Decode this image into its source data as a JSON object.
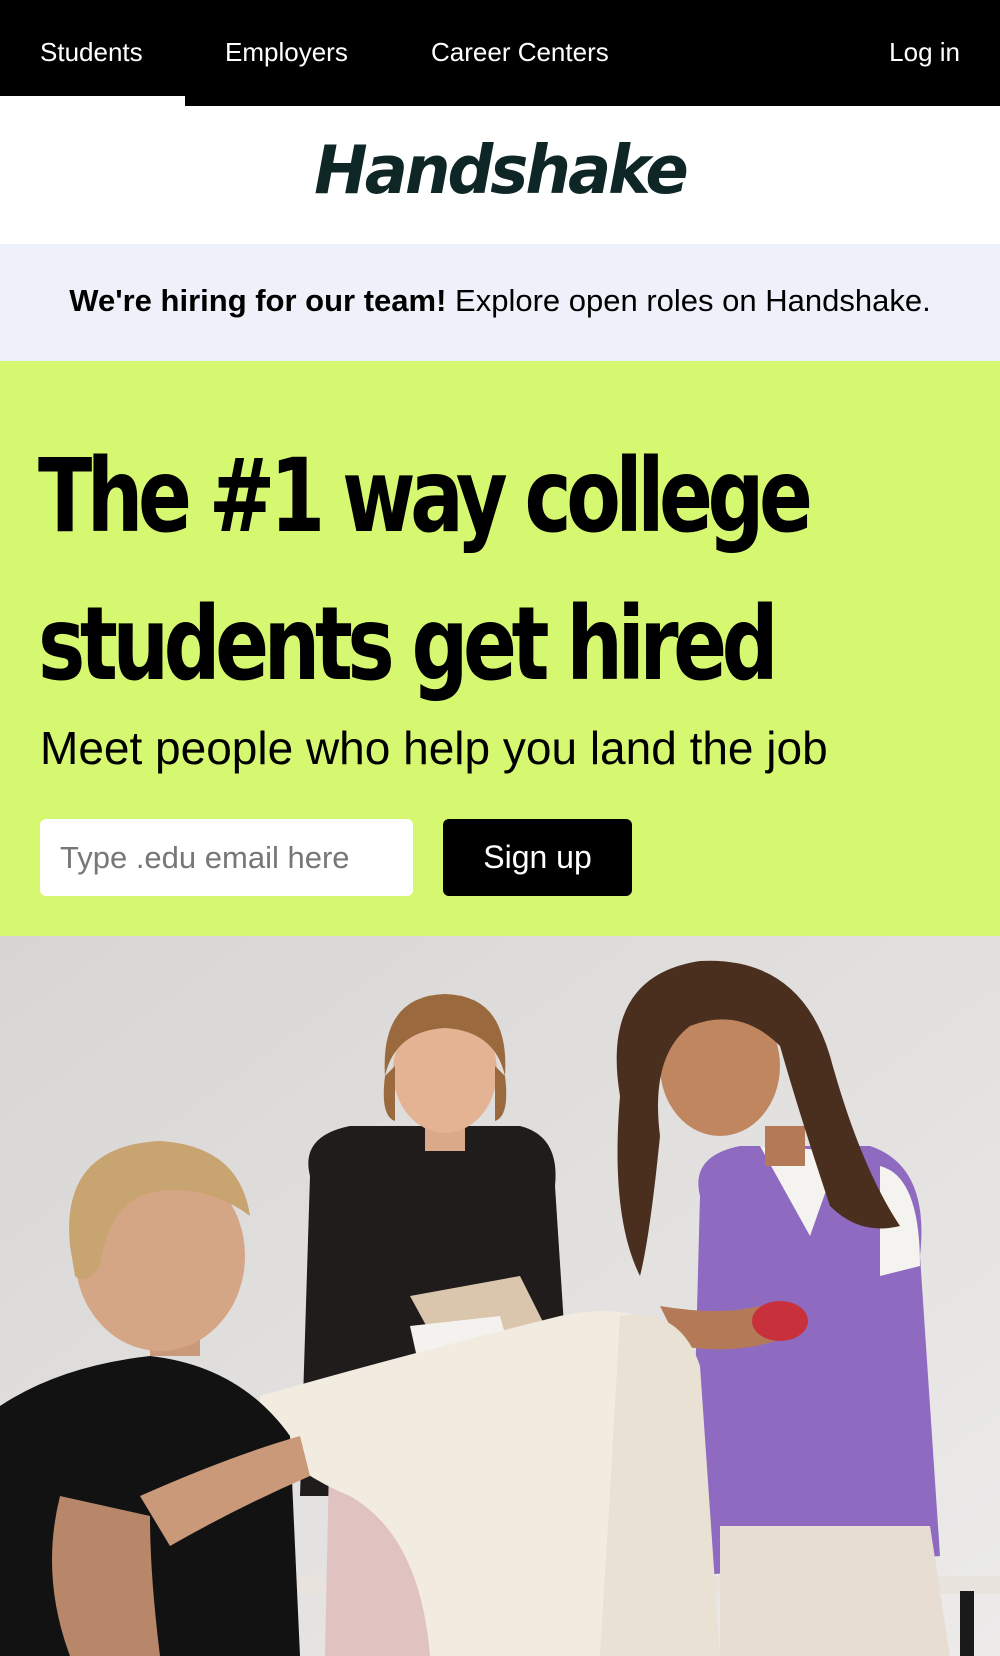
{
  "nav": {
    "items": [
      {
        "label": "Students",
        "active": true
      },
      {
        "label": "Employers"
      },
      {
        "label": "Career Centers"
      }
    ],
    "login_label": "Log in"
  },
  "logo": {
    "text": "Handshake"
  },
  "banner": {
    "bold": "We're hiring for our team!",
    "text": "Explore open roles on Handshake."
  },
  "hero": {
    "headline_line1": "The #1 way college",
    "headline_line2": "students get hired",
    "subheadline": "Meet people who help you land the job",
    "email_placeholder": "Type .edu email here",
    "email_value": "",
    "signup_label": "Sign up"
  },
  "colors": {
    "nav_bg": "#000000",
    "hero_bg": "#d6f871",
    "banner_bg": "#eef1fa",
    "logo": "#0f2626",
    "button_bg": "#000000"
  }
}
